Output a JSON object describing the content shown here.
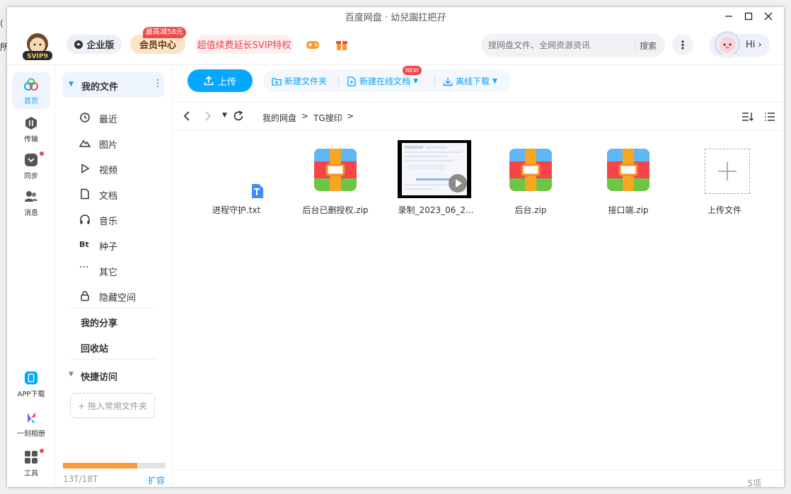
{
  "window": {
    "title": "百度网盘 · 幼兒園扛把孖"
  },
  "background": {
    "fragment_top": "(",
    "fragment_left": "所"
  },
  "header": {
    "logo_text": "SVIP9",
    "enterprise_label": "企业版",
    "vip_center_label": "会员中心",
    "vip_badge": "最高减58元",
    "svip_promo_label": "超值续费延长SVIP特权",
    "search": {
      "placeholder": "搜网盘文件、全网资源资讯",
      "button": "搜索"
    },
    "more_label": "⋮",
    "hi_label": "Hi ›"
  },
  "rail": {
    "items": [
      {
        "label": "首页"
      },
      {
        "label": "传输"
      },
      {
        "label": "同步"
      },
      {
        "label": "消息"
      }
    ],
    "bottom": [
      {
        "label": "APP下载"
      },
      {
        "label": "一刻相册"
      },
      {
        "label": "工具"
      }
    ]
  },
  "sidebar": {
    "my_files": "我的文件",
    "items": [
      {
        "label": "最近"
      },
      {
        "label": "图片"
      },
      {
        "label": "视频"
      },
      {
        "label": "文档"
      },
      {
        "label": "音乐"
      },
      {
        "label": "种子",
        "icon_text": "Bt"
      },
      {
        "label": "其它"
      },
      {
        "label": "隐藏空间"
      }
    ],
    "my_share": "我的分享",
    "recycle": "回收站",
    "quick_access": "快捷访问",
    "drop_hint": "+ 拖入常用文件夹",
    "quota": {
      "text": "13T/18T",
      "used_fraction": 0.722,
      "expand": "扩容"
    }
  },
  "toolbar": {
    "upload": "上传",
    "new_folder": "新建文件夹",
    "new_online_doc": "新建在线文档",
    "new_badge": "NEW",
    "offline_download": "离线下载"
  },
  "breadcrumb": {
    "root": "我的网盘",
    "current": "TG搜印"
  },
  "files": [
    {
      "name": "进程守护.txt",
      "type": "txt"
    },
    {
      "name": "后台已删授权.zip",
      "type": "zip"
    },
    {
      "name": "录制_2023_06_2...",
      "type": "video"
    },
    {
      "name": "后台.zip",
      "type": "zip"
    },
    {
      "name": "接口端.zip",
      "type": "zip"
    },
    {
      "name": "上传文件",
      "type": "upload"
    }
  ],
  "status": {
    "count": "5项"
  },
  "colors": {
    "accent": "#06a7ff",
    "quota_fill": "#f79b3b",
    "promo_red": "#f0424f"
  }
}
